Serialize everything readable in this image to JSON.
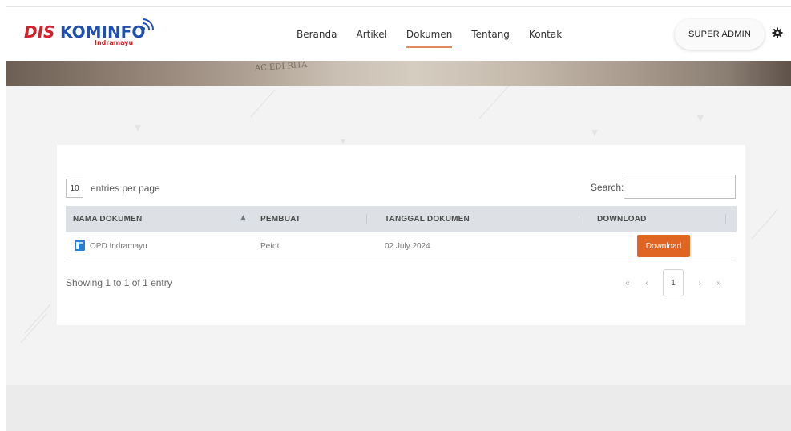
{
  "brand": {
    "logo_prefix": "DIS",
    "logo_main": "KOMINFO",
    "logo_sub": "Indramayu"
  },
  "nav": {
    "items": [
      {
        "label": "Beranda"
      },
      {
        "label": "Artikel"
      },
      {
        "label": "Dokumen"
      },
      {
        "label": "Tentang"
      },
      {
        "label": "Kontak"
      }
    ],
    "active": "Dokumen",
    "admin_label": "SUPER ADMIN",
    "settings_icon": "gear-icon"
  },
  "banner": {
    "text": "AC EDI RITA"
  },
  "table_controls": {
    "per_page_value": "10",
    "per_page_label": "entries per page",
    "search_label": "Search:",
    "search_value": "",
    "search_placeholder": ""
  },
  "table": {
    "columns": [
      "NAMA DOKUMEN",
      "PEMBUAT",
      "TANGGAL DOKUMEN",
      "DOWNLOAD"
    ],
    "rows": [
      {
        "nama": "OPD Indramayu",
        "pembuat": "Petot",
        "tanggal": "02 July 2024",
        "download_label": "Download",
        "icon": "document-icon"
      }
    ]
  },
  "footer": {
    "info": "Showing 1 to 1 of 1 entry",
    "pagination": {
      "first": "«",
      "prev": "‹",
      "current": "1",
      "next": "›",
      "last": "»"
    }
  },
  "colors": {
    "accent": "#e06422",
    "nav_underline": "#e08a5a",
    "logo_red": "#d4202a",
    "logo_blue": "#1f4fb0"
  }
}
